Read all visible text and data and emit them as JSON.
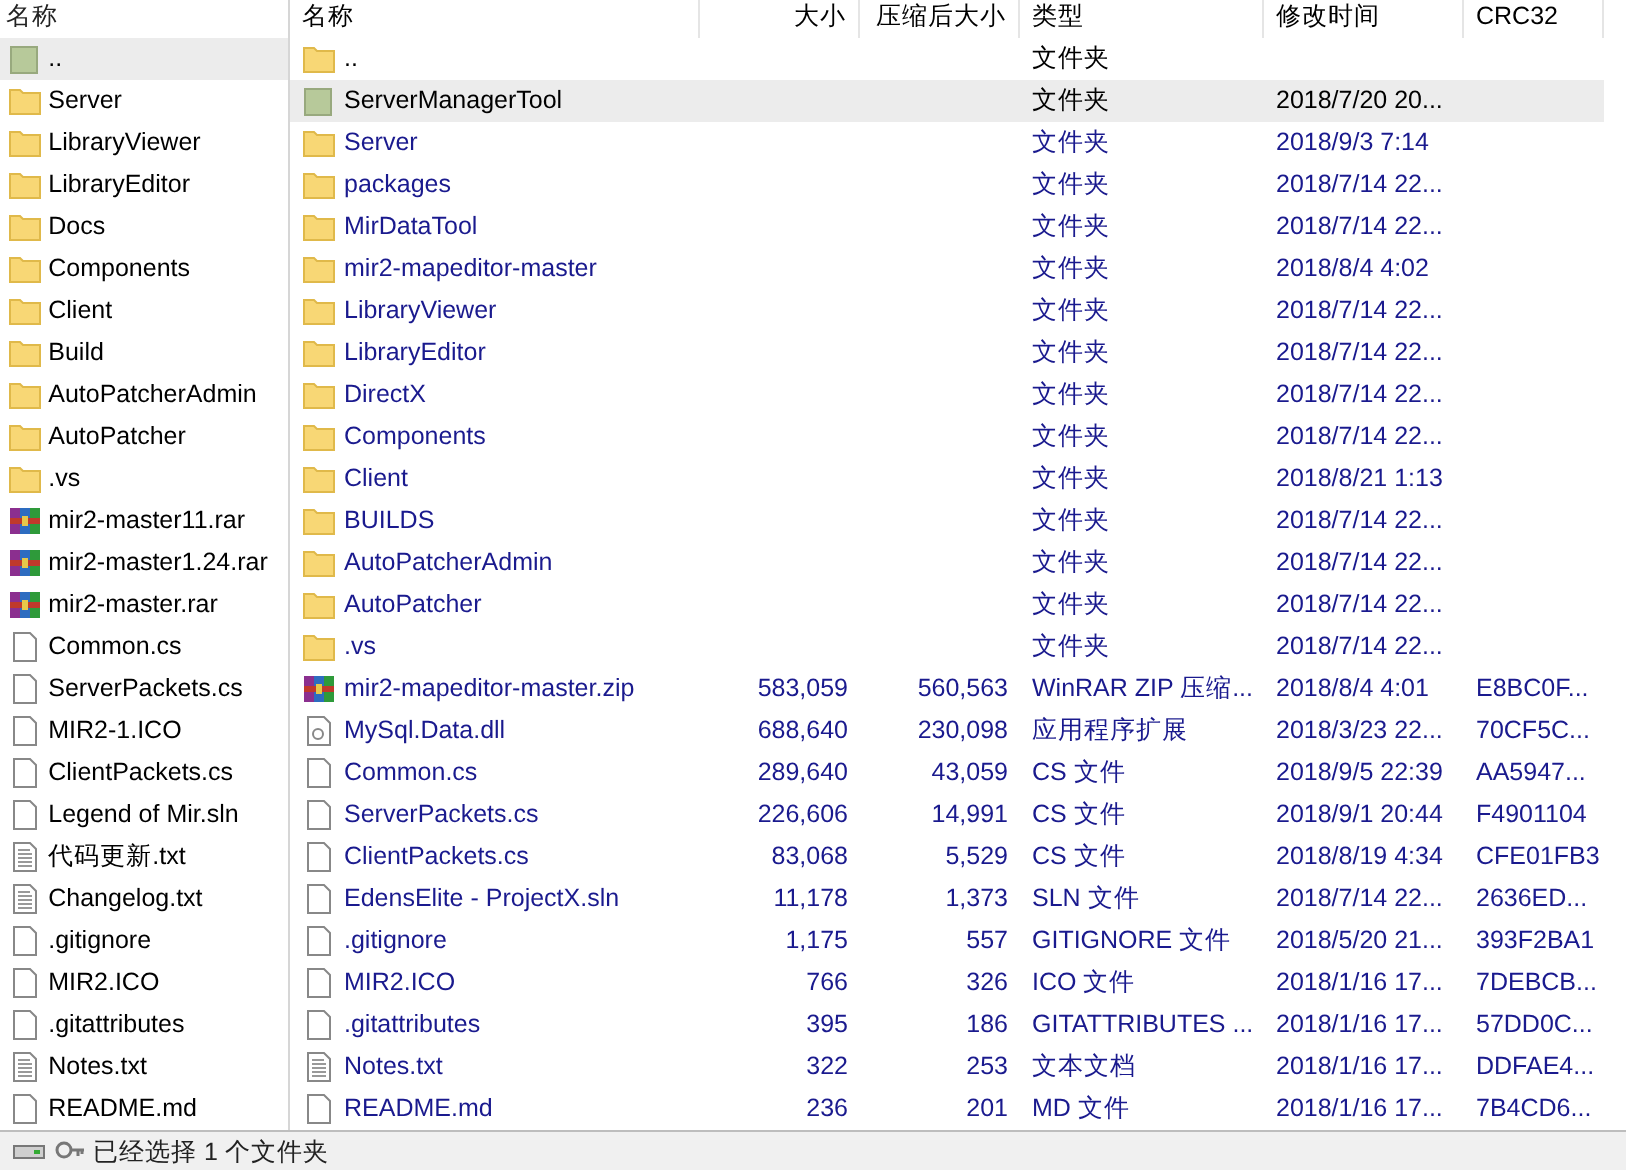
{
  "left_pane": {
    "header": "名称",
    "items": [
      {
        "name": "..",
        "kind": "up",
        "selected": true
      },
      {
        "name": "Server",
        "kind": "folder",
        "selected": false
      },
      {
        "name": "LibraryViewer",
        "kind": "folder",
        "selected": false
      },
      {
        "name": "LibraryEditor",
        "kind": "folder",
        "selected": false
      },
      {
        "name": "Docs",
        "kind": "folder",
        "selected": false
      },
      {
        "name": "Components",
        "kind": "folder",
        "selected": false
      },
      {
        "name": "Client",
        "kind": "folder",
        "selected": false
      },
      {
        "name": "Build",
        "kind": "folder",
        "selected": false
      },
      {
        "name": "AutoPatcherAdmin",
        "kind": "folder",
        "selected": false
      },
      {
        "name": "AutoPatcher",
        "kind": "folder",
        "selected": false
      },
      {
        "name": ".vs",
        "kind": "folder",
        "selected": false
      },
      {
        "name": "mir2-master11.rar",
        "kind": "archive",
        "selected": false
      },
      {
        "name": "mir2-master1.24.rar",
        "kind": "archive",
        "selected": false
      },
      {
        "name": "mir2-master.rar",
        "kind": "archive",
        "selected": false
      },
      {
        "name": "Common.cs",
        "kind": "file",
        "selected": false
      },
      {
        "name": "ServerPackets.cs",
        "kind": "file",
        "selected": false
      },
      {
        "name": "MIR2-1.ICO",
        "kind": "file",
        "selected": false
      },
      {
        "name": "ClientPackets.cs",
        "kind": "file",
        "selected": false
      },
      {
        "name": "Legend of Mir.sln",
        "kind": "file",
        "selected": false
      },
      {
        "name": "代码更新.txt",
        "kind": "text",
        "selected": false
      },
      {
        "name": "Changelog.txt",
        "kind": "text",
        "selected": false
      },
      {
        "name": ".gitignore",
        "kind": "file",
        "selected": false
      },
      {
        "name": "MIR2.ICO",
        "kind": "file",
        "selected": false
      },
      {
        "name": ".gitattributes",
        "kind": "file",
        "selected": false
      },
      {
        "name": "Notes.txt",
        "kind": "text",
        "selected": false
      },
      {
        "name": "README.md",
        "kind": "file",
        "selected": false
      }
    ]
  },
  "archive_list": {
    "columns": [
      "名称",
      "大小",
      "压缩后大小",
      "类型",
      "修改时间",
      "CRC32"
    ],
    "rows": [
      {
        "kind": "folder",
        "color": "#000000",
        "selected": false,
        "cells": [
          "..",
          "",
          "",
          "文件夹",
          "",
          ""
        ]
      },
      {
        "kind": "up",
        "color": "#000000",
        "selected": true,
        "cells": [
          "ServerManagerTool",
          "",
          "",
          "文件夹",
          "2018/7/20 20...",
          ""
        ]
      },
      {
        "kind": "folder",
        "color": "#1a1a8e",
        "selected": false,
        "cells": [
          "Server",
          "",
          "",
          "文件夹",
          "2018/9/3 7:14",
          ""
        ]
      },
      {
        "kind": "folder",
        "color": "#1a1a8e",
        "selected": false,
        "cells": [
          "packages",
          "",
          "",
          "文件夹",
          "2018/7/14 22...",
          ""
        ]
      },
      {
        "kind": "folder",
        "color": "#1a1a8e",
        "selected": false,
        "cells": [
          "MirDataTool",
          "",
          "",
          "文件夹",
          "2018/7/14 22...",
          ""
        ]
      },
      {
        "kind": "folder",
        "color": "#1a1a8e",
        "selected": false,
        "cells": [
          "mir2-mapeditor-master",
          "",
          "",
          "文件夹",
          "2018/8/4 4:02",
          ""
        ]
      },
      {
        "kind": "folder",
        "color": "#1a1a8e",
        "selected": false,
        "cells": [
          "LibraryViewer",
          "",
          "",
          "文件夹",
          "2018/7/14 22...",
          ""
        ]
      },
      {
        "kind": "folder",
        "color": "#1a1a8e",
        "selected": false,
        "cells": [
          "LibraryEditor",
          "",
          "",
          "文件夹",
          "2018/7/14 22...",
          ""
        ]
      },
      {
        "kind": "folder",
        "color": "#1a1a8e",
        "selected": false,
        "cells": [
          "DirectX",
          "",
          "",
          "文件夹",
          "2018/7/14 22...",
          ""
        ]
      },
      {
        "kind": "folder",
        "color": "#1a1a8e",
        "selected": false,
        "cells": [
          "Components",
          "",
          "",
          "文件夹",
          "2018/7/14 22...",
          ""
        ]
      },
      {
        "kind": "folder",
        "color": "#1a1a8e",
        "selected": false,
        "cells": [
          "Client",
          "",
          "",
          "文件夹",
          "2018/8/21 1:13",
          ""
        ]
      },
      {
        "kind": "folder",
        "color": "#1a1a8e",
        "selected": false,
        "cells": [
          "BUILDS",
          "",
          "",
          "文件夹",
          "2018/7/14 22...",
          ""
        ]
      },
      {
        "kind": "folder",
        "color": "#1a1a8e",
        "selected": false,
        "cells": [
          "AutoPatcherAdmin",
          "",
          "",
          "文件夹",
          "2018/7/14 22...",
          ""
        ]
      },
      {
        "kind": "folder",
        "color": "#1a1a8e",
        "selected": false,
        "cells": [
          "AutoPatcher",
          "",
          "",
          "文件夹",
          "2018/7/14 22...",
          ""
        ]
      },
      {
        "kind": "folder",
        "color": "#1a1a8e",
        "selected": false,
        "cells": [
          ".vs",
          "",
          "",
          "文件夹",
          "2018/7/14 22...",
          ""
        ]
      },
      {
        "kind": "archive",
        "color": "#1a1a8e",
        "selected": false,
        "cells": [
          "mir2-mapeditor-master.zip",
          "583,059",
          "560,563",
          "WinRAR ZIP 压缩...",
          "2018/8/4 4:01",
          "E8BC0F..."
        ]
      },
      {
        "kind": "library",
        "color": "#1a1a8e",
        "selected": false,
        "cells": [
          "MySql.Data.dll",
          "688,640",
          "230,098",
          "应用程序扩展",
          "2018/3/23 22...",
          "70CF5C..."
        ]
      },
      {
        "kind": "file",
        "color": "#1a1a8e",
        "selected": false,
        "cells": [
          "Common.cs",
          "289,640",
          "43,059",
          "CS 文件",
          "2018/9/5 22:39",
          "AA5947..."
        ]
      },
      {
        "kind": "file",
        "color": "#1a1a8e",
        "selected": false,
        "cells": [
          "ServerPackets.cs",
          "226,606",
          "14,991",
          "CS 文件",
          "2018/9/1 20:44",
          "F4901104"
        ]
      },
      {
        "kind": "file",
        "color": "#1a1a8e",
        "selected": false,
        "cells": [
          "ClientPackets.cs",
          "83,068",
          "5,529",
          "CS 文件",
          "2018/8/19 4:34",
          "CFE01FB3"
        ]
      },
      {
        "kind": "file",
        "color": "#1a1a8e",
        "selected": false,
        "cells": [
          "EdensElite - ProjectX.sln",
          "11,178",
          "1,373",
          "SLN 文件",
          "2018/7/14 22...",
          "2636ED..."
        ]
      },
      {
        "kind": "file",
        "color": "#1a1a8e",
        "selected": false,
        "cells": [
          ".gitignore",
          "1,175",
          "557",
          "GITIGNORE 文件",
          "2018/5/20 21...",
          "393F2BA1"
        ]
      },
      {
        "kind": "file",
        "color": "#1a1a8e",
        "selected": false,
        "cells": [
          "MIR2.ICO",
          "766",
          "326",
          "ICO 文件",
          "2018/1/16 17...",
          "7DEBCB..."
        ]
      },
      {
        "kind": "file",
        "color": "#1a1a8e",
        "selected": false,
        "cells": [
          ".gitattributes",
          "395",
          "186",
          "GITATTRIBUTES ...",
          "2018/1/16 17...",
          "57DD0C..."
        ]
      },
      {
        "kind": "text",
        "color": "#1a1a8e",
        "selected": false,
        "cells": [
          "Notes.txt",
          "322",
          "253",
          "文本文档",
          "2018/1/16 17...",
          "DDFAE4..."
        ]
      },
      {
        "kind": "file",
        "color": "#1a1a8e",
        "selected": false,
        "cells": [
          "README.md",
          "236",
          "201",
          "MD 文件",
          "2018/1/16 17...",
          "7B4CD6..."
        ]
      }
    ]
  },
  "status_bar": {
    "text": "已经选择 1 个文件夹"
  }
}
